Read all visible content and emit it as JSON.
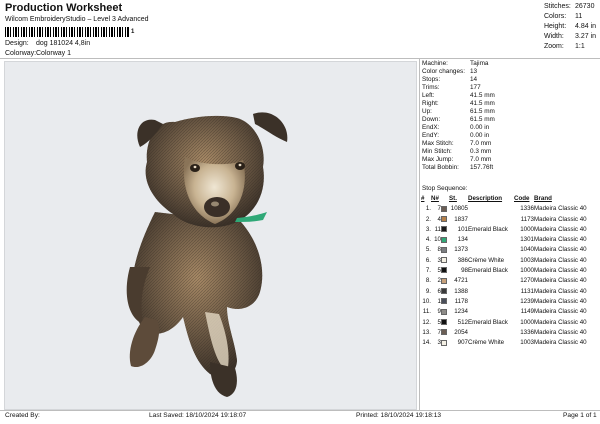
{
  "header": {
    "title": "Production Worksheet",
    "subtitle": "Wilcom EmbroideryStudio – Level 3 Advanced",
    "barcode_number": "1",
    "design_label": "Design:",
    "design_value": "dog 181024 4,8in",
    "colorway_label": "Colorway:",
    "colorway_value": "Colorway 1"
  },
  "stats": [
    {
      "label": "Stitches:",
      "value": "26730"
    },
    {
      "label": "Colors:",
      "value": "11"
    },
    {
      "label": "Height:",
      "value": "4.84 in"
    },
    {
      "label": "Width:",
      "value": "3.27 in"
    },
    {
      "label": "Zoom:",
      "value": "1:1"
    }
  ],
  "machine_info": [
    {
      "label": "Machine:",
      "value": "Tajima"
    },
    {
      "label": "Color changes:",
      "value": "13"
    },
    {
      "label": "Stops:",
      "value": "14"
    },
    {
      "label": "Trims:",
      "value": "177"
    },
    {
      "label": "Left:",
      "value": "41.5 mm"
    },
    {
      "label": "Right:",
      "value": "41.5 mm"
    },
    {
      "label": "Up:",
      "value": "61.5 mm"
    },
    {
      "label": "Down:",
      "value": "61.5 mm"
    },
    {
      "label": "EndX:",
      "value": "0.00 in"
    },
    {
      "label": "EndY:",
      "value": "0.00 in"
    },
    {
      "label": "Max Stitch:",
      "value": "7.0 mm"
    },
    {
      "label": "Min Stitch:",
      "value": "0.3 mm"
    },
    {
      "label": "Max Jump:",
      "value": "7.0 mm"
    },
    {
      "label": "Total Bobbin:",
      "value": "157.76ft"
    }
  ],
  "stop_sequence": {
    "title": "Stop Sequence:",
    "headers": [
      "#",
      "N#",
      "",
      "St.",
      "Description",
      "Code",
      "Brand"
    ],
    "rows": [
      {
        "n": "1.",
        "num": "7",
        "color": "#6b5e55",
        "st": "10805",
        "desc": "",
        "code": "1336",
        "brand": "Madeira Classic 40"
      },
      {
        "n": "2.",
        "num": "4",
        "color": "#b5804a",
        "st": "1837",
        "desc": "",
        "code": "1173",
        "brand": "Madeira Classic 40"
      },
      {
        "n": "3.",
        "num": "11",
        "color": "#1a1a1a",
        "st": "101",
        "desc": "Emerald Black",
        "code": "1000",
        "brand": "Madeira Classic 40"
      },
      {
        "n": "4.",
        "num": "10",
        "color": "#2fa877",
        "st": "134",
        "desc": "",
        "code": "1301",
        "brand": "Madeira Classic 40"
      },
      {
        "n": "5.",
        "num": "8",
        "color": "#7b7d80",
        "st": "1373",
        "desc": "",
        "code": "1040",
        "brand": "Madeira Classic 40"
      },
      {
        "n": "6.",
        "num": "3",
        "color": "#f4f0e4",
        "st": "386",
        "desc": "Crème White",
        "code": "1003",
        "brand": "Madeira Classic 40"
      },
      {
        "n": "7.",
        "num": "5",
        "color": "#111111",
        "st": "98",
        "desc": "Emerald Black",
        "code": "1000",
        "brand": "Madeira Classic 40"
      },
      {
        "n": "8.",
        "num": "2",
        "color": "#c6a07a",
        "st": "4721",
        "desc": "",
        "code": "1270",
        "brand": "Madeira Classic 40"
      },
      {
        "n": "9.",
        "num": "6",
        "color": "#3a3a3a",
        "st": "1388",
        "desc": "",
        "code": "1131",
        "brand": "Madeira Classic 40"
      },
      {
        "n": "10.",
        "num": "1",
        "color": "#4a4f5a",
        "st": "1178",
        "desc": "",
        "code": "1239",
        "brand": "Madeira Classic 40"
      },
      {
        "n": "11.",
        "num": "9",
        "color": "#8e8c88",
        "st": "1234",
        "desc": "",
        "code": "1149",
        "brand": "Madeira Classic 40"
      },
      {
        "n": "12.",
        "num": "5",
        "color": "#111111",
        "st": "512",
        "desc": "Emerald Black",
        "code": "1000",
        "brand": "Madeira Classic 40"
      },
      {
        "n": "13.",
        "num": "7",
        "color": "#6b5e55",
        "st": "2054",
        "desc": "",
        "code": "1336",
        "brand": "Madeira Classic 40"
      },
      {
        "n": "14.",
        "num": "3",
        "color": "#f4f0e4",
        "st": "907",
        "desc": "Crème White",
        "code": "1003",
        "brand": "Madeira Classic 40"
      }
    ]
  },
  "footer": {
    "created_by": "Created By:",
    "last_saved": "Last Saved: 18/10/2024 19:18:07",
    "printed": "Printed: 18/10/2024 19:18:13",
    "page": "Page 1 of 1"
  }
}
